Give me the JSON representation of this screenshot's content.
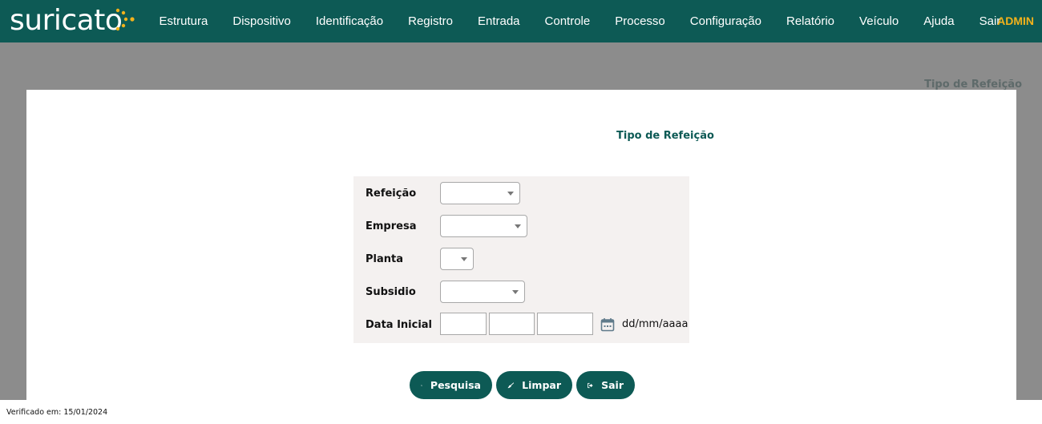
{
  "app": {
    "logo": "suricato",
    "user": "ADMIN"
  },
  "nav": [
    "Estrutura",
    "Dispositivo",
    "Identificação",
    "Registro",
    "Entrada",
    "Controle",
    "Processo",
    "Configuração",
    "Relatório",
    "Veículo",
    "Ajuda",
    "Sair"
  ],
  "background": {
    "page_title": "Tipo de Refeição"
  },
  "modal": {
    "title": "Tipo de Refeição",
    "fields": {
      "refeicao": {
        "label": "Refeição",
        "value": ""
      },
      "empresa": {
        "label": "Empresa",
        "value": ""
      },
      "planta": {
        "label": "Planta",
        "value": ""
      },
      "subsidio": {
        "label": "Subsidio",
        "value": ""
      },
      "data_inicial": {
        "label": "Data Inicial",
        "day": "",
        "month": "",
        "year": "",
        "format_hint": "dd/mm/aaaa"
      }
    },
    "buttons": {
      "search": "Pesquisa",
      "clear": "Limpar",
      "exit": "Sair"
    }
  },
  "footer": {
    "verified": "Verificado em: 15/01/2024"
  },
  "colors": {
    "primary": "#0d5a55",
    "accent": "#f3b21b",
    "overlay": "#8c8c8c",
    "form_bg": "#f4f1f0"
  },
  "icons": [
    "search-icon",
    "broom-icon",
    "sign-out-icon",
    "calendar-icon"
  ]
}
